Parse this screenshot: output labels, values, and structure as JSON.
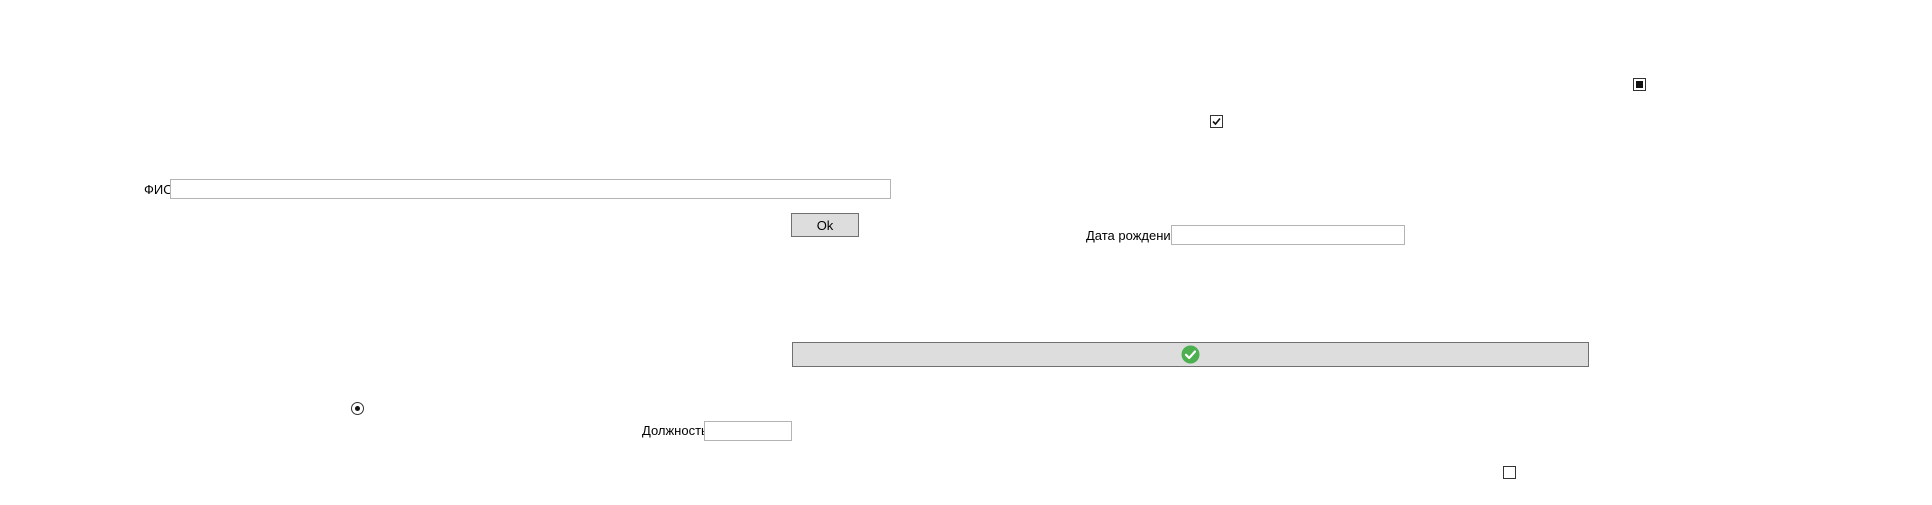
{
  "form": {
    "fio_label": "ФИО",
    "fio_value": "",
    "ok_label": "Ok",
    "birthdate_label": "Дата рождения",
    "birthdate_value": "",
    "position_label": "Должность",
    "position_value": ""
  },
  "icons": {
    "wide_button_icon": "check-circle-icon",
    "accent": "#4caf50"
  },
  "controls": {
    "checkbox_top": "indeterminate",
    "checkbox_middle": "checked",
    "checkbox_bottom": "unchecked",
    "radio": "selected"
  }
}
